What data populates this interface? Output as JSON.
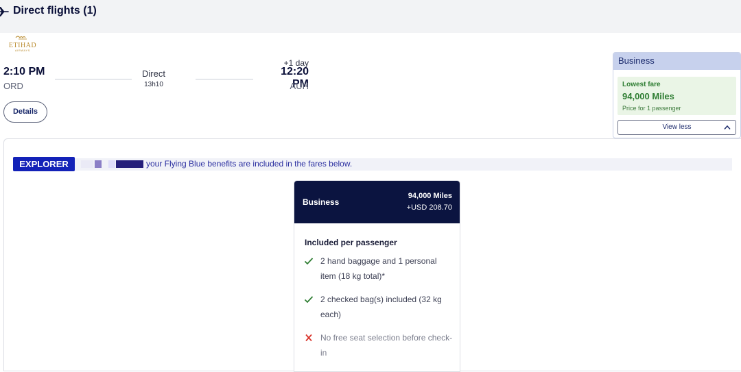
{
  "header": {
    "title": "Direct flights (1)"
  },
  "flight": {
    "airline_logo_text": "ETIHAD AIRWAYS",
    "departure": {
      "time": "2:10 PM",
      "airport": "ORD"
    },
    "arrival": {
      "time": "12:20 PM",
      "airport": "AUH",
      "day_offset": "+1 day"
    },
    "stop_type": "Direct",
    "duration": "13h10",
    "details_label": "Details"
  },
  "cabin_summary": {
    "cabin": "Business",
    "lowest_fare_label": "Lowest fare",
    "miles": "94,000 Miles",
    "price_note": "Price for 1 passenger",
    "toggle_label": "View less"
  },
  "benefits": {
    "tier_badge": "EXPLORER",
    "text": "your Flying Blue benefits are included in the fares below."
  },
  "fare_card": {
    "cabin": "Business",
    "miles": "94,000 Miles",
    "cash": "+USD 208.70",
    "included_title": "Included per passenger",
    "features": [
      {
        "text": "2 hand baggage and 1 personal item (18 kg total)*",
        "included": true
      },
      {
        "text": "2 checked bag(s) included (32 kg each)",
        "included": true
      },
      {
        "text": "No free seat selection before check-in",
        "included": false
      }
    ]
  },
  "colors": {
    "brand_navy": "#0b1440",
    "explorer_blue": "#1322b8",
    "positive_green": "#2e7d32",
    "negative_red": "#d9342b"
  }
}
